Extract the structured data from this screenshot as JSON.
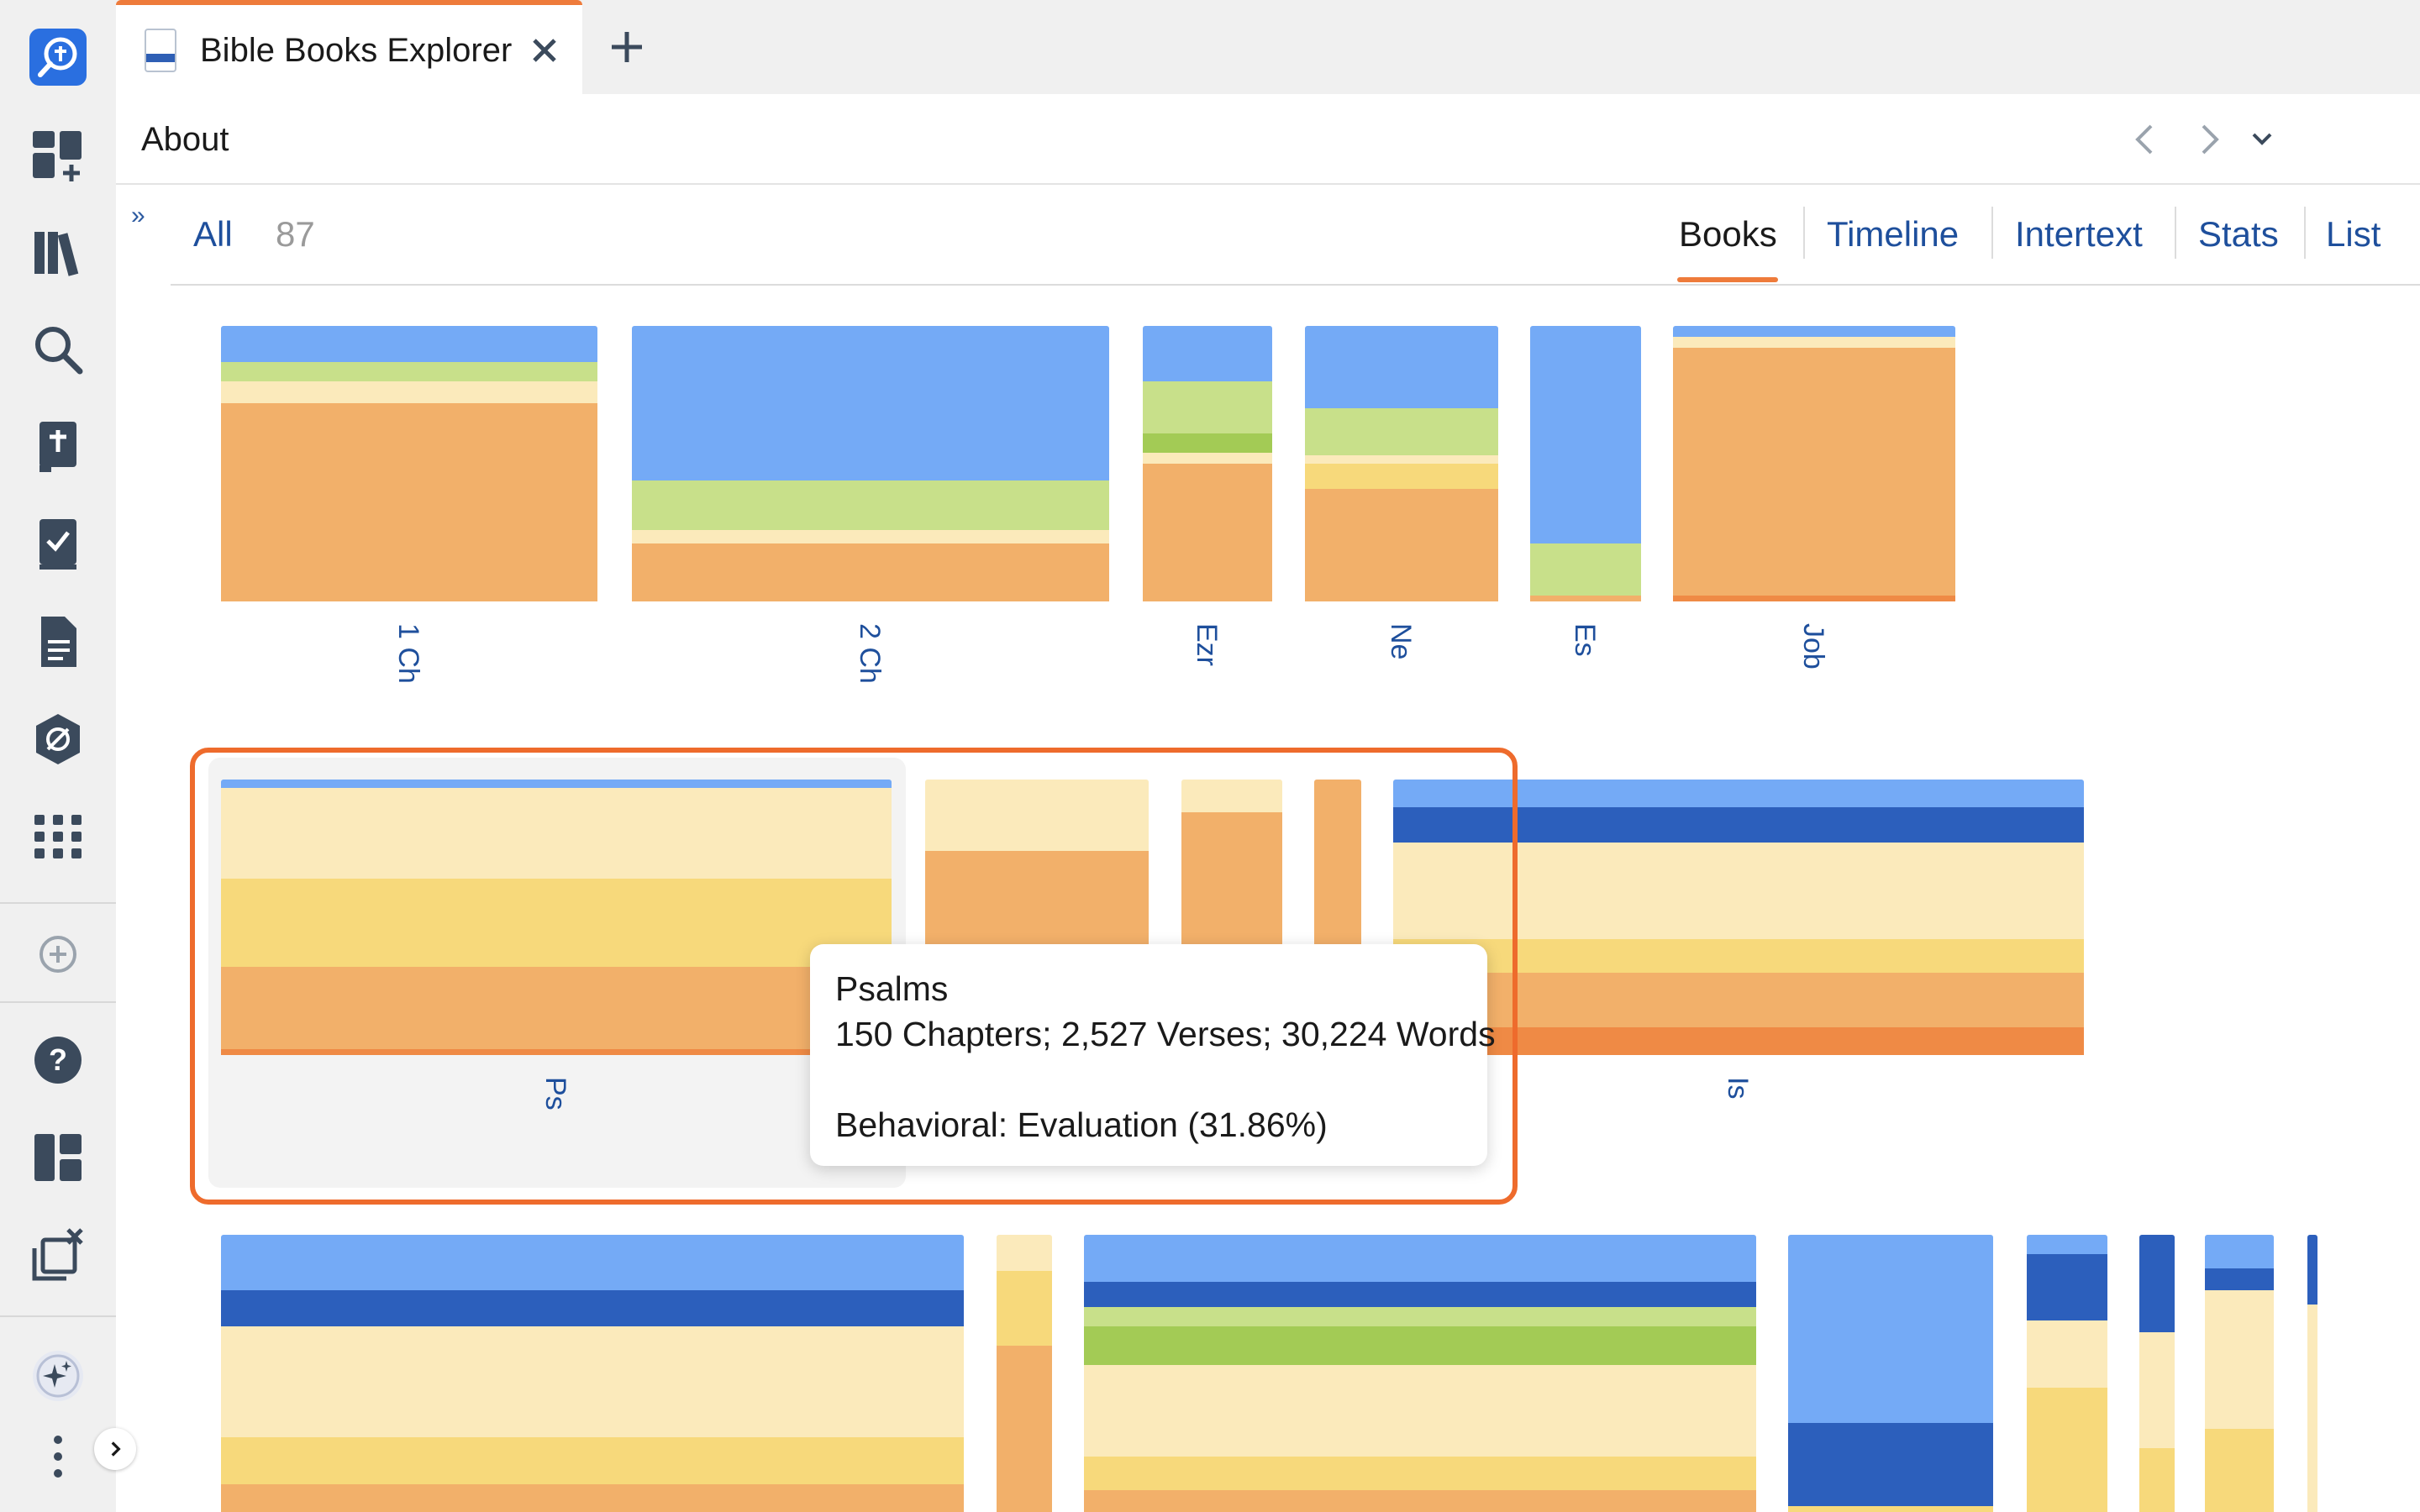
{
  "tab": {
    "title": "Bible Books Explorer"
  },
  "header": {
    "title": "About"
  },
  "filter": {
    "all_label": "All",
    "count": "87"
  },
  "views": [
    {
      "label": "Books",
      "active": true
    },
    {
      "label": "Timeline",
      "active": false
    },
    {
      "label": "Intertext",
      "active": false
    },
    {
      "label": "Stats",
      "active": false
    },
    {
      "label": "List",
      "active": false
    }
  ],
  "sidebar": {
    "icons": [
      "bible-search-icon",
      "dashboard-add-icon",
      "library-icon",
      "search-icon",
      "bible-icon",
      "checklist-icon",
      "document-icon",
      "atlas-icon",
      "apps-grid-icon",
      "add-icon",
      "help-icon",
      "layouts-icon",
      "close-panels-icon",
      "ai-sparkle-icon",
      "more-icon",
      "expand-icon"
    ]
  },
  "colors": {
    "accent": "#ee7b3b",
    "link": "#1e4f9c",
    "blue_light": "#74aaf6",
    "blue_dark": "#2c5fbc",
    "green_light": "#c8e08a",
    "green": "#a3cb55",
    "cream": "#fbeabb",
    "yellow": "#f7d97b",
    "orange_light": "#f2b06a",
    "orange": "#ef8a45"
  },
  "books": [
    {
      "label": "1 Ch",
      "segments": [
        {
          "color": "#74aaf6",
          "fraction": 0.13
        },
        {
          "color": "#c8e08a",
          "fraction": 0.07
        },
        {
          "color": "#fbeabb",
          "fraction": 0.08
        },
        {
          "color": "#f2b06a",
          "fraction": 0.72
        }
      ]
    },
    {
      "label": "2 Ch",
      "segments": [
        {
          "color": "#74aaf6",
          "fraction": 0.56
        },
        {
          "color": "#c8e08a",
          "fraction": 0.18
        },
        {
          "color": "#fbeabb",
          "fraction": 0.05
        },
        {
          "color": "#f2b06a",
          "fraction": 0.21
        }
      ]
    },
    {
      "label": "Ezr",
      "segments": [
        {
          "color": "#74aaf6",
          "fraction": 0.2
        },
        {
          "color": "#c8e08a",
          "fraction": 0.19
        },
        {
          "color": "#a3cb55",
          "fraction": 0.07
        },
        {
          "color": "#fbeabb",
          "fraction": 0.04
        },
        {
          "color": "#f2b06a",
          "fraction": 0.5
        }
      ]
    },
    {
      "label": "Ne",
      "segments": [
        {
          "color": "#74aaf6",
          "fraction": 0.3
        },
        {
          "color": "#c8e08a",
          "fraction": 0.17
        },
        {
          "color": "#fbeabb",
          "fraction": 0.03
        },
        {
          "color": "#f7d97b",
          "fraction": 0.09
        },
        {
          "color": "#f2b06a",
          "fraction": 0.41
        }
      ]
    },
    {
      "label": "Es",
      "segments": [
        {
          "color": "#74aaf6",
          "fraction": 0.79
        },
        {
          "color": "#c8e08a",
          "fraction": 0.19
        },
        {
          "color": "#f2b06a",
          "fraction": 0.02
        }
      ]
    },
    {
      "label": "Job",
      "segments": [
        {
          "color": "#74aaf6",
          "fraction": 0.04
        },
        {
          "color": "#fbeabb",
          "fraction": 0.04
        },
        {
          "color": "#f2b06a",
          "fraction": 0.9
        },
        {
          "color": "#ef8a45",
          "fraction": 0.02
        }
      ]
    },
    {
      "label": "Ps",
      "segments": [
        {
          "color": "#74aaf6",
          "fraction": 0.03
        },
        {
          "color": "#fbeabb",
          "fraction": 0.33
        },
        {
          "color": "#f7d97b",
          "fraction": 0.32
        },
        {
          "color": "#f2b06a",
          "fraction": 0.3
        },
        {
          "color": "#ef8a45",
          "fraction": 0.02
        }
      ]
    },
    {
      "label": "",
      "segments": [
        {
          "color": "#fbeabb",
          "fraction": 0.26
        },
        {
          "color": "#f2b06a",
          "fraction": 0.74
        }
      ]
    },
    {
      "label": "",
      "segments": [
        {
          "color": "#fbeabb",
          "fraction": 0.12
        },
        {
          "color": "#f2b06a",
          "fraction": 0.88
        }
      ]
    },
    {
      "label": "",
      "segments": [
        {
          "color": "#f2b06a",
          "fraction": 1.0
        }
      ]
    },
    {
      "label": "Is",
      "segments": [
        {
          "color": "#74aaf6",
          "fraction": 0.1
        },
        {
          "color": "#2c5fbc",
          "fraction": 0.13
        },
        {
          "color": "#fbeabb",
          "fraction": 0.35
        },
        {
          "color": "#f7d97b",
          "fraction": 0.12
        },
        {
          "color": "#f2b06a",
          "fraction": 0.2
        },
        {
          "color": "#ef8a45",
          "fraction": 0.1
        }
      ]
    },
    {
      "label": "",
      "segments": [
        {
          "color": "#74aaf6",
          "fraction": 0.2
        },
        {
          "color": "#2c5fbc",
          "fraction": 0.13
        },
        {
          "color": "#fbeabb",
          "fraction": 0.4
        },
        {
          "color": "#f7d97b",
          "fraction": 0.17
        },
        {
          "color": "#f2b06a",
          "fraction": 0.1
        }
      ]
    },
    {
      "label": "",
      "segments": [
        {
          "color": "#fbeabb",
          "fraction": 0.13
        },
        {
          "color": "#f7d97b",
          "fraction": 0.27
        },
        {
          "color": "#f2b06a",
          "fraction": 0.6
        }
      ]
    },
    {
      "label": "",
      "segments": [
        {
          "color": "#74aaf6",
          "fraction": 0.17
        },
        {
          "color": "#2c5fbc",
          "fraction": 0.09
        },
        {
          "color": "#c8e08a",
          "fraction": 0.07
        },
        {
          "color": "#a3cb55",
          "fraction": 0.14
        },
        {
          "color": "#fbeabb",
          "fraction": 0.33
        },
        {
          "color": "#f7d97b",
          "fraction": 0.12
        },
        {
          "color": "#f2b06a",
          "fraction": 0.08
        }
      ]
    },
    {
      "label": "",
      "segments": [
        {
          "color": "#74aaf6",
          "fraction": 0.68
        },
        {
          "color": "#2c5fbc",
          "fraction": 0.3
        },
        {
          "color": "#f7d97b",
          "fraction": 0.02
        }
      ]
    },
    {
      "label": "",
      "segments": [
        {
          "color": "#74aaf6",
          "fraction": 0.07
        },
        {
          "color": "#2c5fbc",
          "fraction": 0.24
        },
        {
          "color": "#fbeabb",
          "fraction": 0.24
        },
        {
          "color": "#f7d97b",
          "fraction": 0.45
        }
      ]
    },
    {
      "label": "",
      "segments": [
        {
          "color": "#2c5fbc",
          "fraction": 0.35
        },
        {
          "color": "#fbeabb",
          "fraction": 0.42
        },
        {
          "color": "#f7d97b",
          "fraction": 0.23
        }
      ]
    },
    {
      "label": "",
      "segments": [
        {
          "color": "#74aaf6",
          "fraction": 0.12
        },
        {
          "color": "#2c5fbc",
          "fraction": 0.08
        },
        {
          "color": "#fbeabb",
          "fraction": 0.5
        },
        {
          "color": "#f7d97b",
          "fraction": 0.3
        }
      ]
    },
    {
      "label": "",
      "segments": [
        {
          "color": "#2c5fbc",
          "fraction": 0.25
        },
        {
          "color": "#fbeabb",
          "fraction": 0.75
        }
      ]
    }
  ],
  "tooltip": {
    "title": "Psalms",
    "stats": "150 Chapters; 2,527 Verses; 30,224 Words",
    "detail": "Behavioral: Evaluation (31.86%)"
  }
}
